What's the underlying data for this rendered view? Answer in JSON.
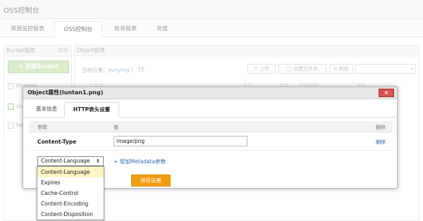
{
  "app": {
    "title": "OSS控制台"
  },
  "tabs": [
    {
      "label": "资源监控报表"
    },
    {
      "label": "OSS控制台"
    },
    {
      "label": "账单报表"
    },
    {
      "label": "充值"
    }
  ],
  "left_panel": {
    "header": "Bucket管理",
    "refresh": "刷新",
    "create_button": "+ 创建Bucket",
    "buckets": [
      "bluesea",
      "yu",
      "ba"
    ]
  },
  "right_panel": {
    "header": "Object管理",
    "breadcrumb": {
      "prefix": "当前位置：",
      "bucket": "yunying",
      "sep": "〉",
      "folder": "TT"
    },
    "toolbar": {
      "upload": "上传",
      "create_folder": "创建文件夹",
      "refresh": "刷新"
    },
    "columns": [
      "文件名",
      "大小",
      "类型",
      "创建时间",
      "操作"
    ]
  },
  "dialog": {
    "title": "Object属性(luntan1.png)",
    "close": "×",
    "tabs": [
      {
        "label": "基本信息"
      },
      {
        "label": "HTTP表头设置"
      }
    ],
    "table_headers": {
      "param": "参数",
      "value": "值",
      "delete": "删除"
    },
    "row": {
      "param": "Content-Type",
      "value": "image/png",
      "delete": "删除"
    },
    "select": {
      "selected": "Content-Language"
    },
    "add_metadata": "+ 增加Metadata参数",
    "save": "保存设置",
    "dropdown_options": [
      "Content-Language",
      "Expires",
      "Cache-Control",
      "Content-Encoding",
      "Content-Disposition"
    ]
  },
  "colors": {
    "accent": "#f39c12",
    "close": "#d9534f",
    "link": "#2d6db5",
    "create": "#c5e4b0"
  }
}
